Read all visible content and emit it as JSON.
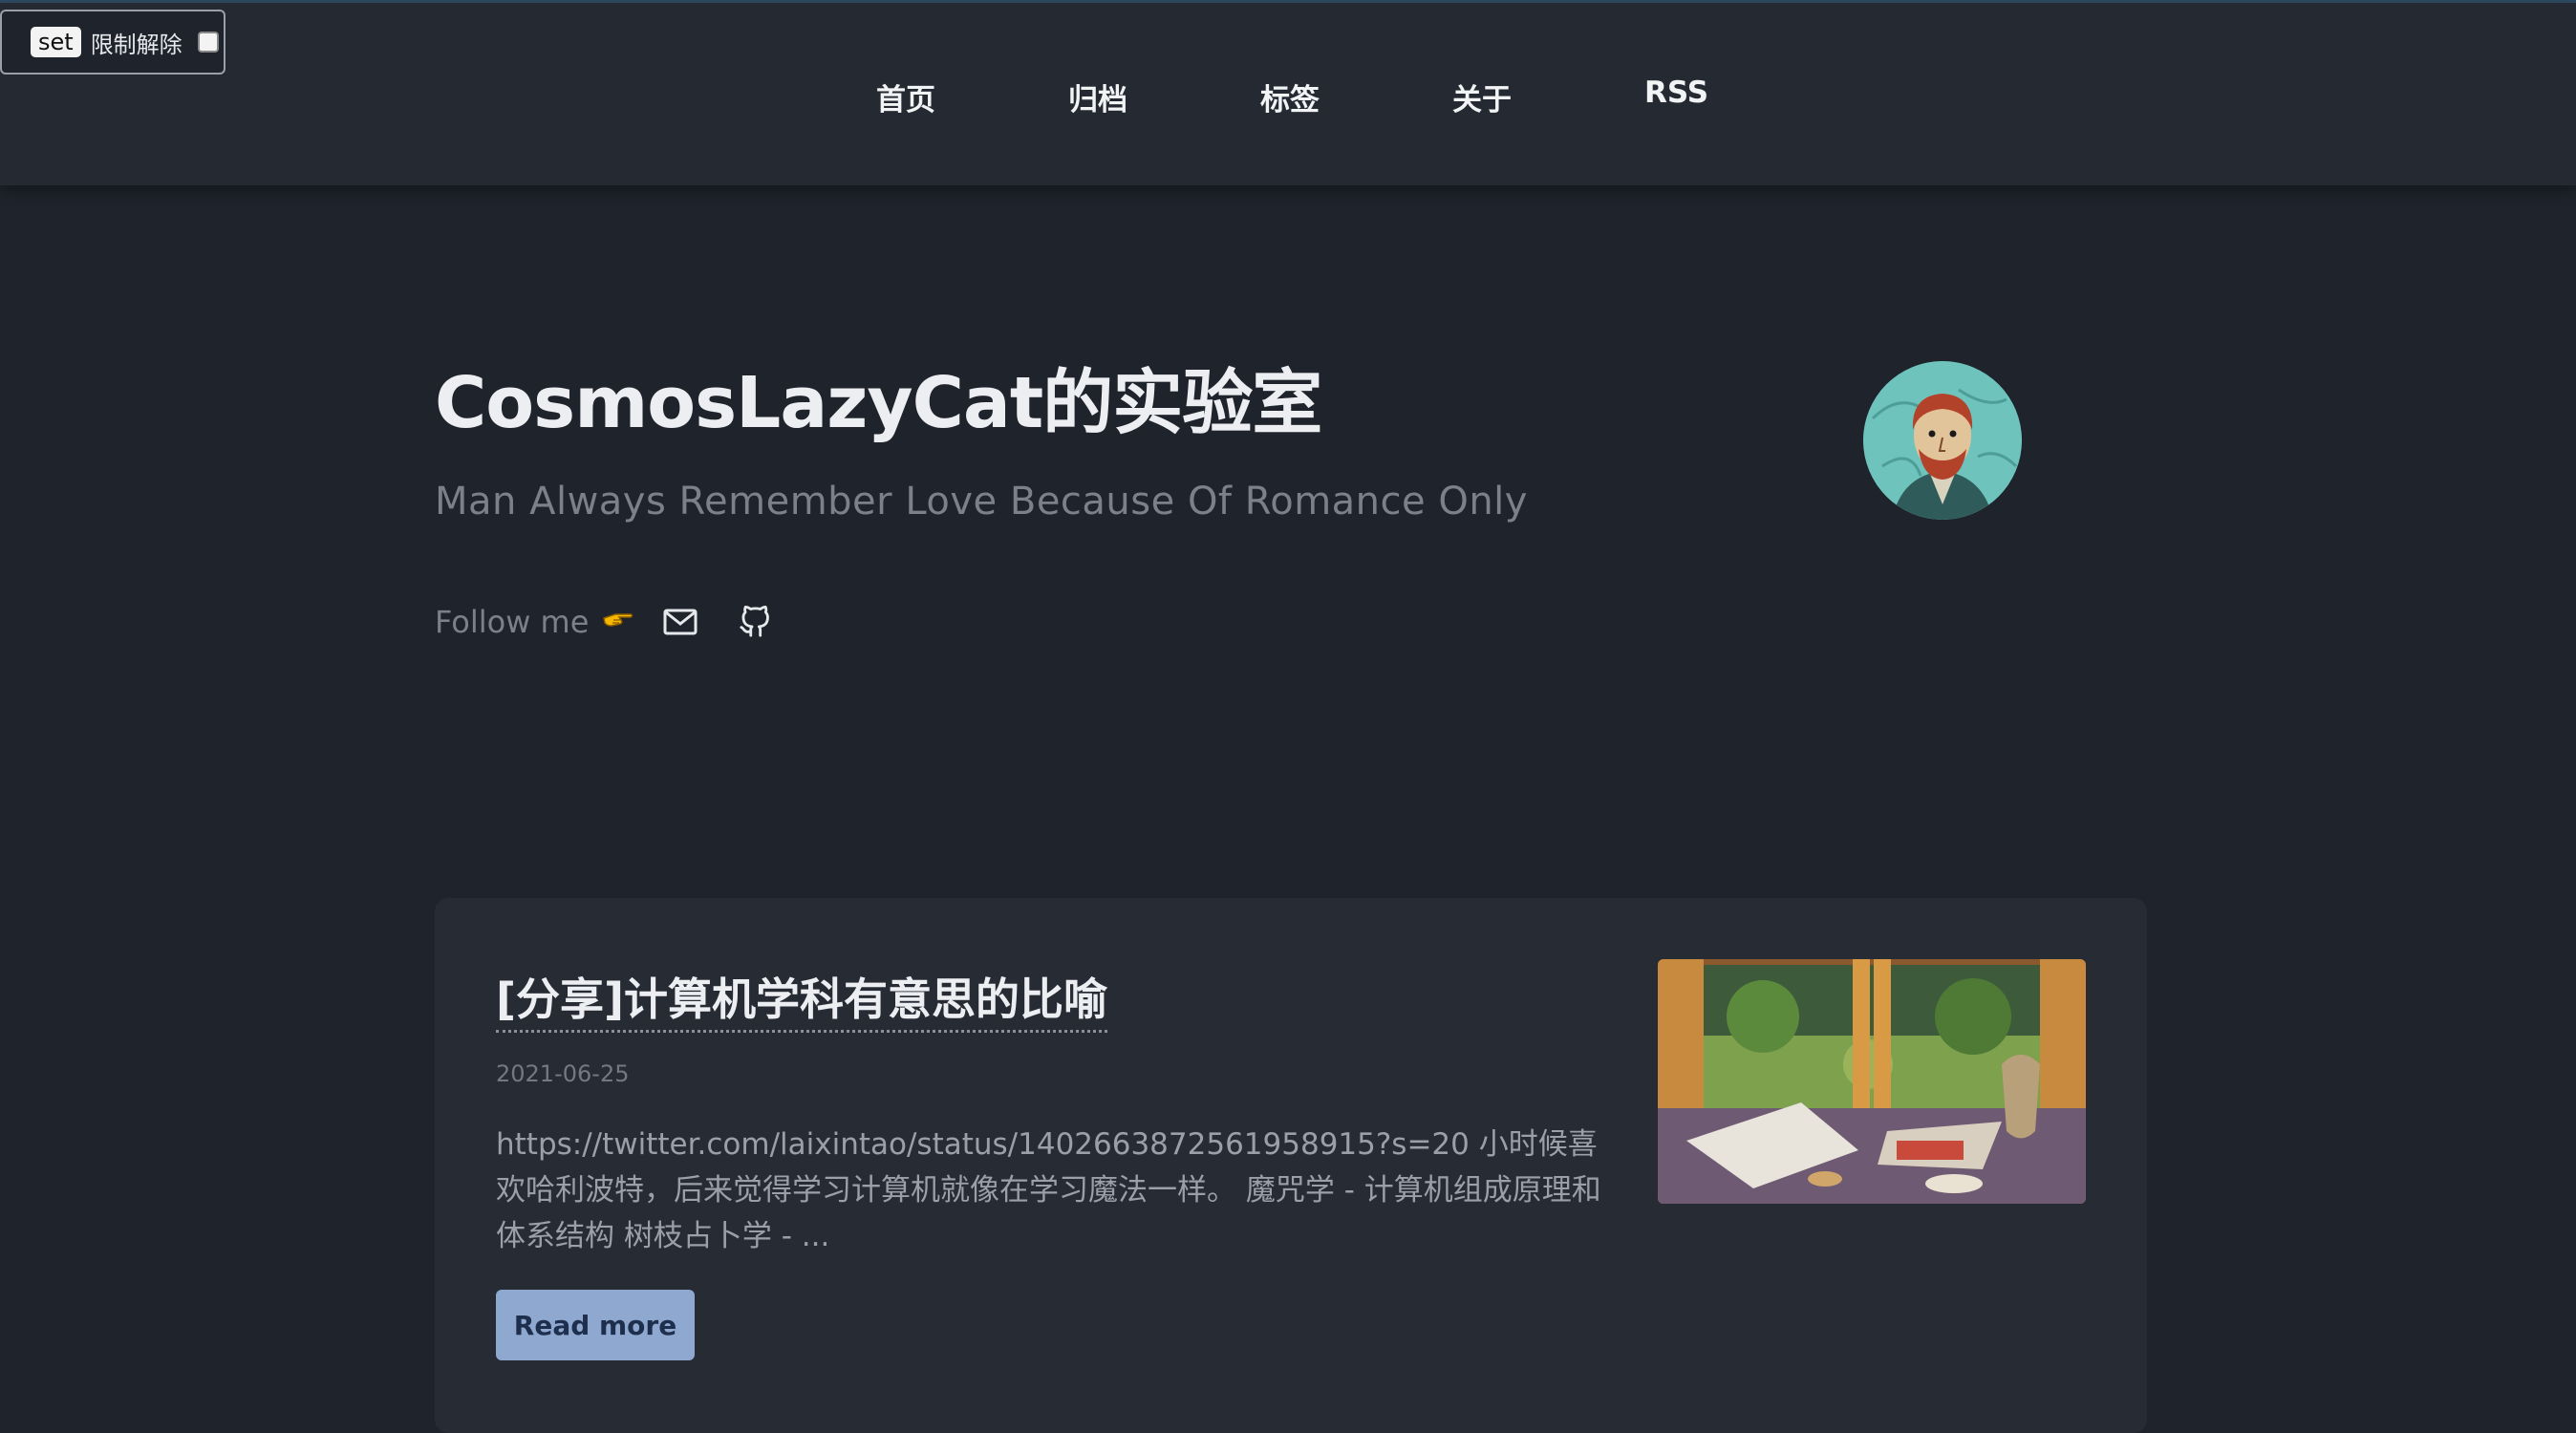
{
  "widget": {
    "tag": "set",
    "label": "限制解除"
  },
  "nav": {
    "items": [
      {
        "label": "首页"
      },
      {
        "label": "归档"
      },
      {
        "label": "标签"
      },
      {
        "label": "关于"
      },
      {
        "label": "RSS"
      }
    ]
  },
  "hero": {
    "title": "CosmosLazyCat的实验室",
    "subtitle": "Man Always Remember Love Because Of Romance Only",
    "follow_text": "Follow me",
    "icons": [
      "pointing-hand-icon",
      "mail-icon",
      "github-icon",
      "avatar"
    ]
  },
  "post": {
    "title": "[分享]计算机学科有意思的比喻",
    "date": "2021-06-25",
    "excerpt": "https://twitter.com/laixintao/status/1402663872561958915?s=20 小时候喜欢哈利波特，后来觉得学习计算机就像在学习魔法一样。 魔咒学 - 计算机组成原理和体系结构 树枝占卜学 - ...",
    "read_more": "Read more"
  },
  "colors": {
    "background": "#1f232b",
    "navbar": "#252932",
    "card": "#272b34",
    "button": "#8fa8d0",
    "button_text": "#1e2f4d"
  }
}
